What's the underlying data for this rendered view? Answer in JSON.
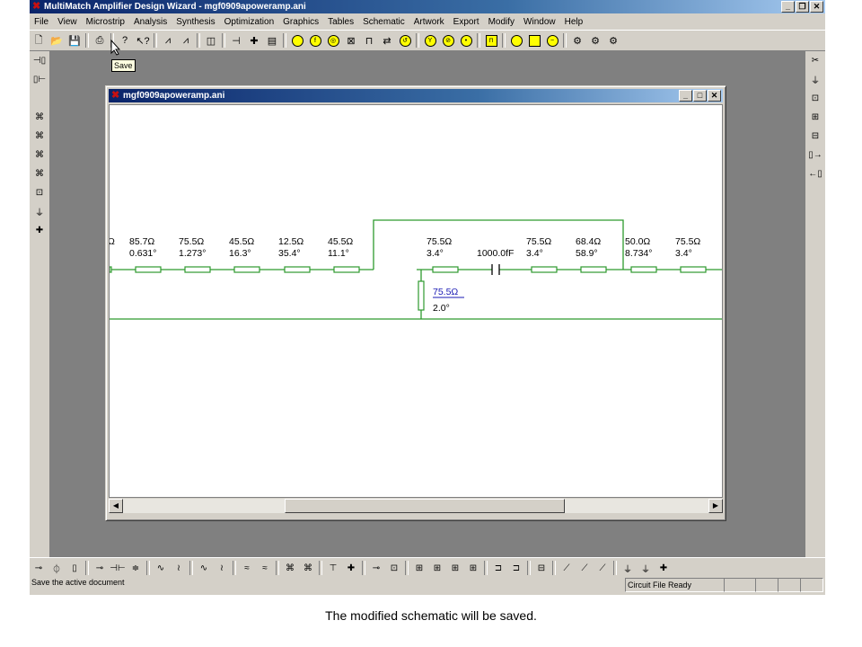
{
  "app": {
    "title": "MultiMatch Amplifier Design Wizard - mgf0909apoweramp.ani"
  },
  "window_controls": {
    "minimize": "_",
    "restore": "❐",
    "close": "✕"
  },
  "menu": [
    "File",
    "View",
    "Microstrip",
    "Analysis",
    "Synthesis",
    "Optimization",
    "Graphics",
    "Tables",
    "Schematic",
    "Artwork",
    "Export",
    "Modify",
    "Window",
    "Help"
  ],
  "tooltip": "Save",
  "child": {
    "title": "mgf0909apoweramp.ani"
  },
  "schematic": {
    "cut_label": "Ω",
    "elements": [
      {
        "z": "85.7Ω",
        "deg": "0.631°"
      },
      {
        "z": "75.5Ω",
        "deg": "1.273°"
      },
      {
        "z": "45.5Ω",
        "deg": "16.3°"
      },
      {
        "z": "12.5Ω",
        "deg": "35.4°"
      },
      {
        "z": "45.5Ω",
        "deg": "11.1°"
      },
      {
        "z": "75.5Ω",
        "deg": "3.4°"
      },
      {
        "z": "1000.0fF",
        "deg": ""
      },
      {
        "z": "75.5Ω",
        "deg": "3.4°"
      },
      {
        "z": "68.4Ω",
        "deg": "58.9°"
      },
      {
        "z": "50.0Ω",
        "deg": "8.734°"
      },
      {
        "z": "75.5Ω",
        "deg": "3.4°"
      }
    ],
    "shunt": {
      "z": "75.5Ω",
      "deg": "2.0°"
    }
  },
  "status": {
    "message": "Save the active document",
    "file_state": "Circuit File Ready"
  },
  "caption": "The modified schematic will be saved.",
  "icons": {
    "toolbar": [
      "new-file-icon",
      "open-folder-icon",
      "save-disk-icon",
      "print-icon",
      "help-icon",
      "context-help-icon"
    ],
    "colors": {
      "titlebar": "#0a246a",
      "wire": "#2e9a2e",
      "shunt_label": "#1a1ab4",
      "logo": "#c81010"
    }
  }
}
